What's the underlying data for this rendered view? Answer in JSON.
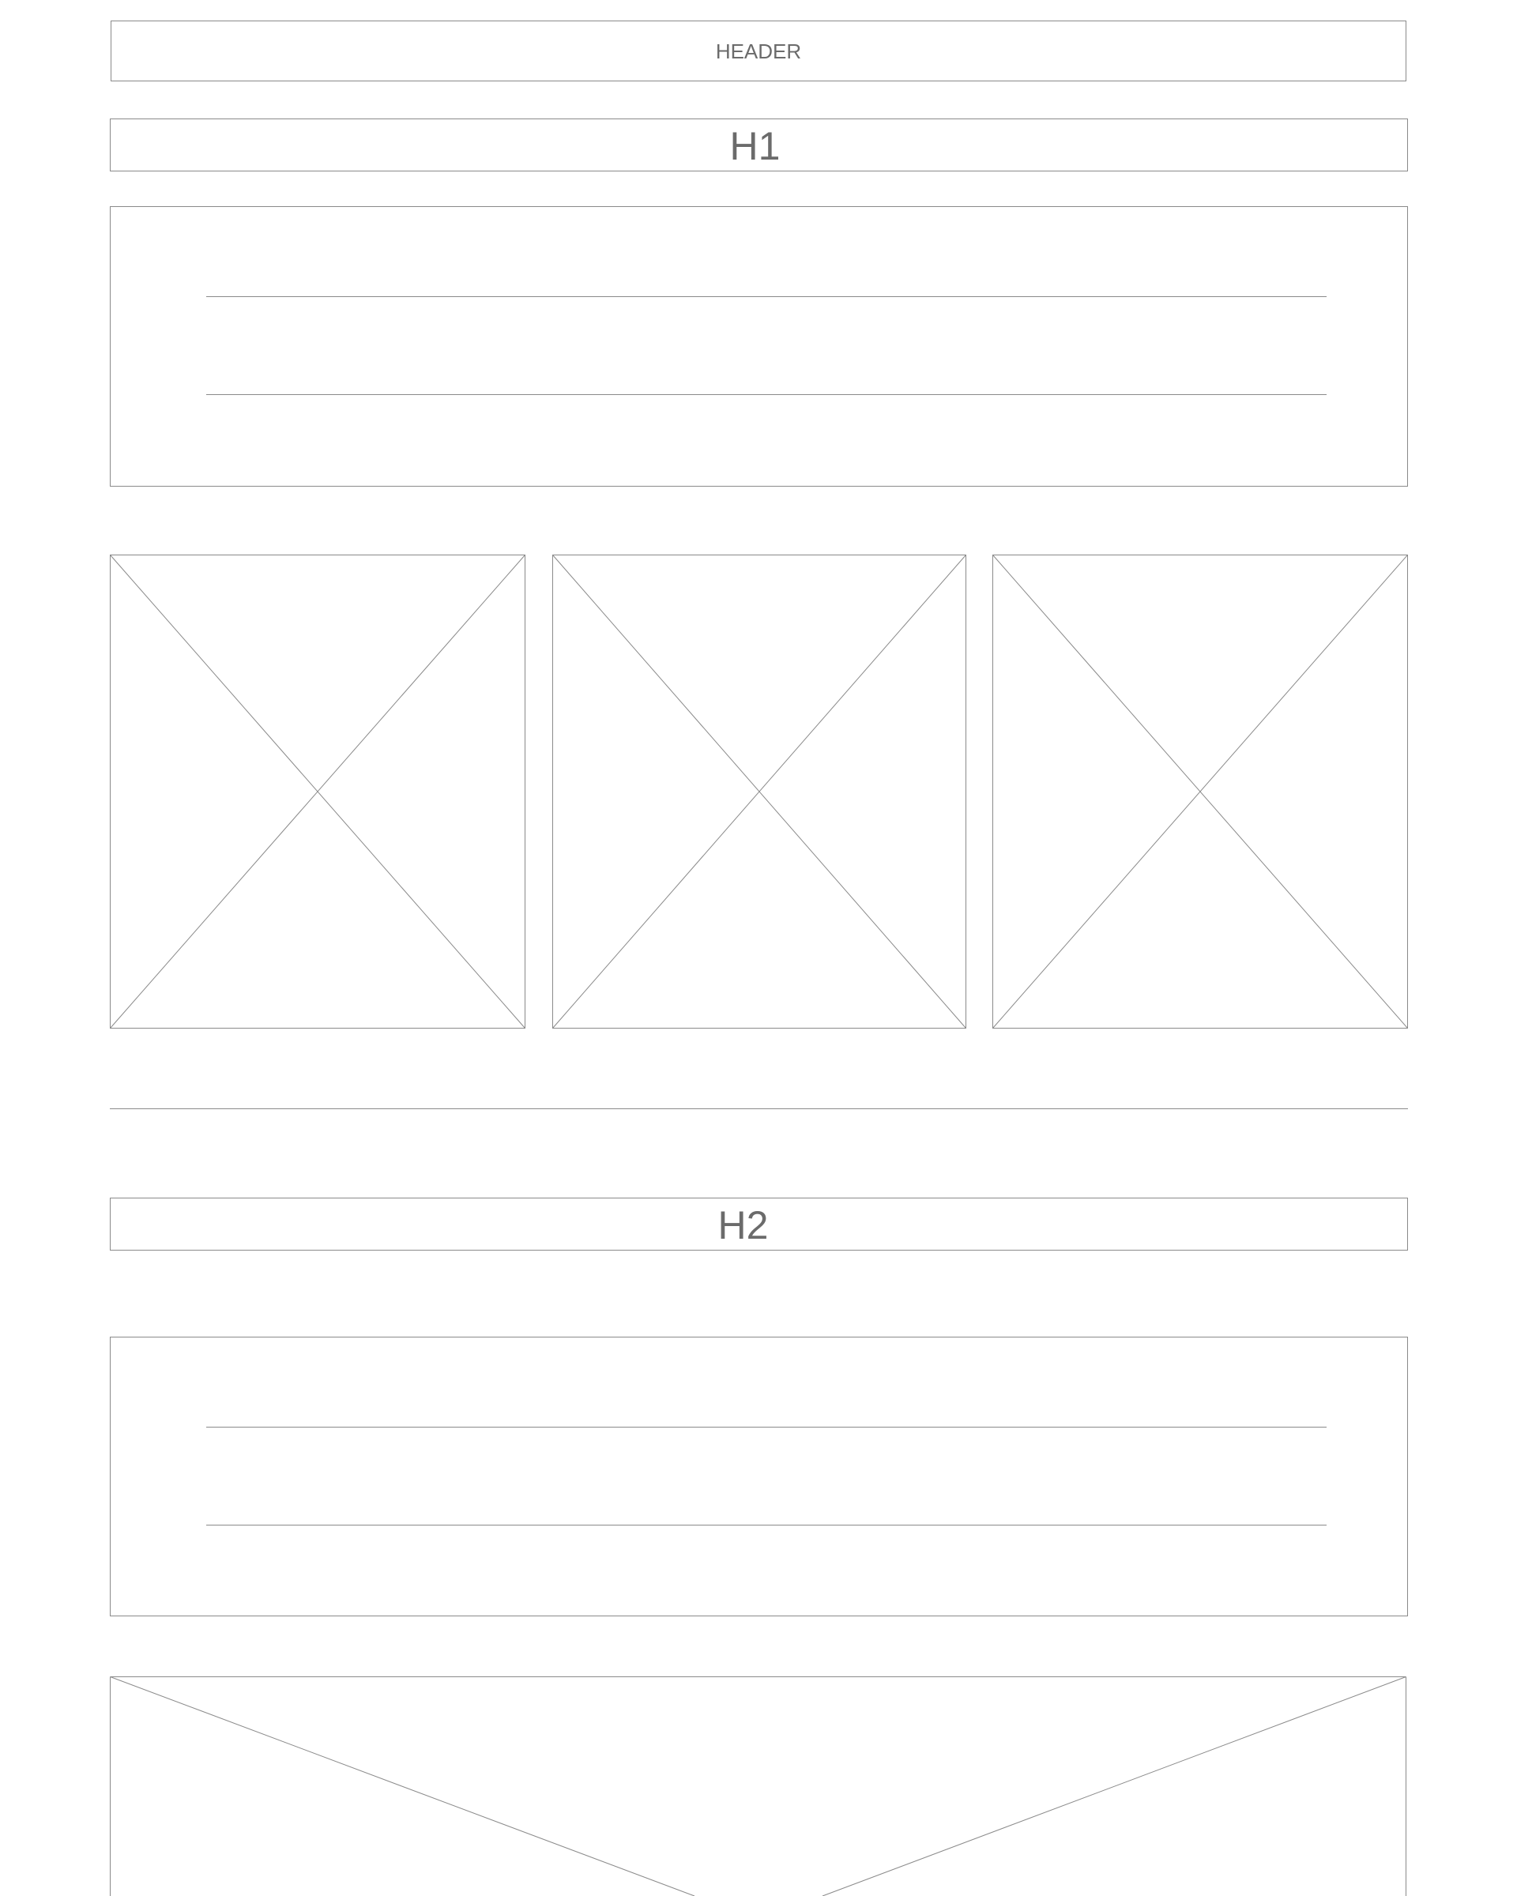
{
  "header": {
    "label": "HEADER"
  },
  "section1": {
    "heading": "H1",
    "text_block": {
      "line_count": 2
    },
    "image_placeholders": [
      {
        "name": "image-placeholder-1"
      },
      {
        "name": "image-placeholder-2"
      },
      {
        "name": "image-placeholder-3"
      }
    ]
  },
  "section2": {
    "heading": "H2",
    "text_block": {
      "line_count": 2
    },
    "image_placeholder": {
      "name": "wide-image-placeholder"
    }
  },
  "colors": {
    "stroke": "#8a8a8a",
    "text": "#6b6b6b",
    "background": "#ffffff"
  }
}
